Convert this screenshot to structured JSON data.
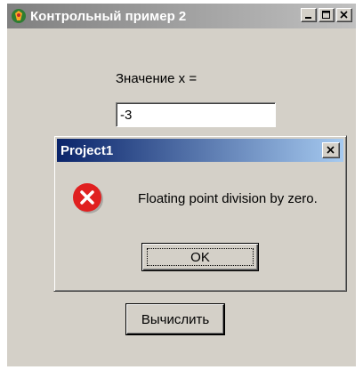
{
  "main_window": {
    "title": "Контрольный пример 2",
    "title_buttons": [
      "minimize-icon",
      "maximize-icon",
      "close-icon"
    ]
  },
  "form": {
    "x_label": "Значение x =",
    "x_value": "-3",
    "calc_label": "Вычислить"
  },
  "dialog": {
    "title": "Project1",
    "message": "Floating point division by zero.",
    "ok_label": "OK",
    "icon": "error-icon"
  },
  "colors": {
    "window_face": "#d4d0c8",
    "dialog_title_start": "#0a246a",
    "dialog_title_end": "#a6caf0",
    "error_red": "#e02020"
  }
}
